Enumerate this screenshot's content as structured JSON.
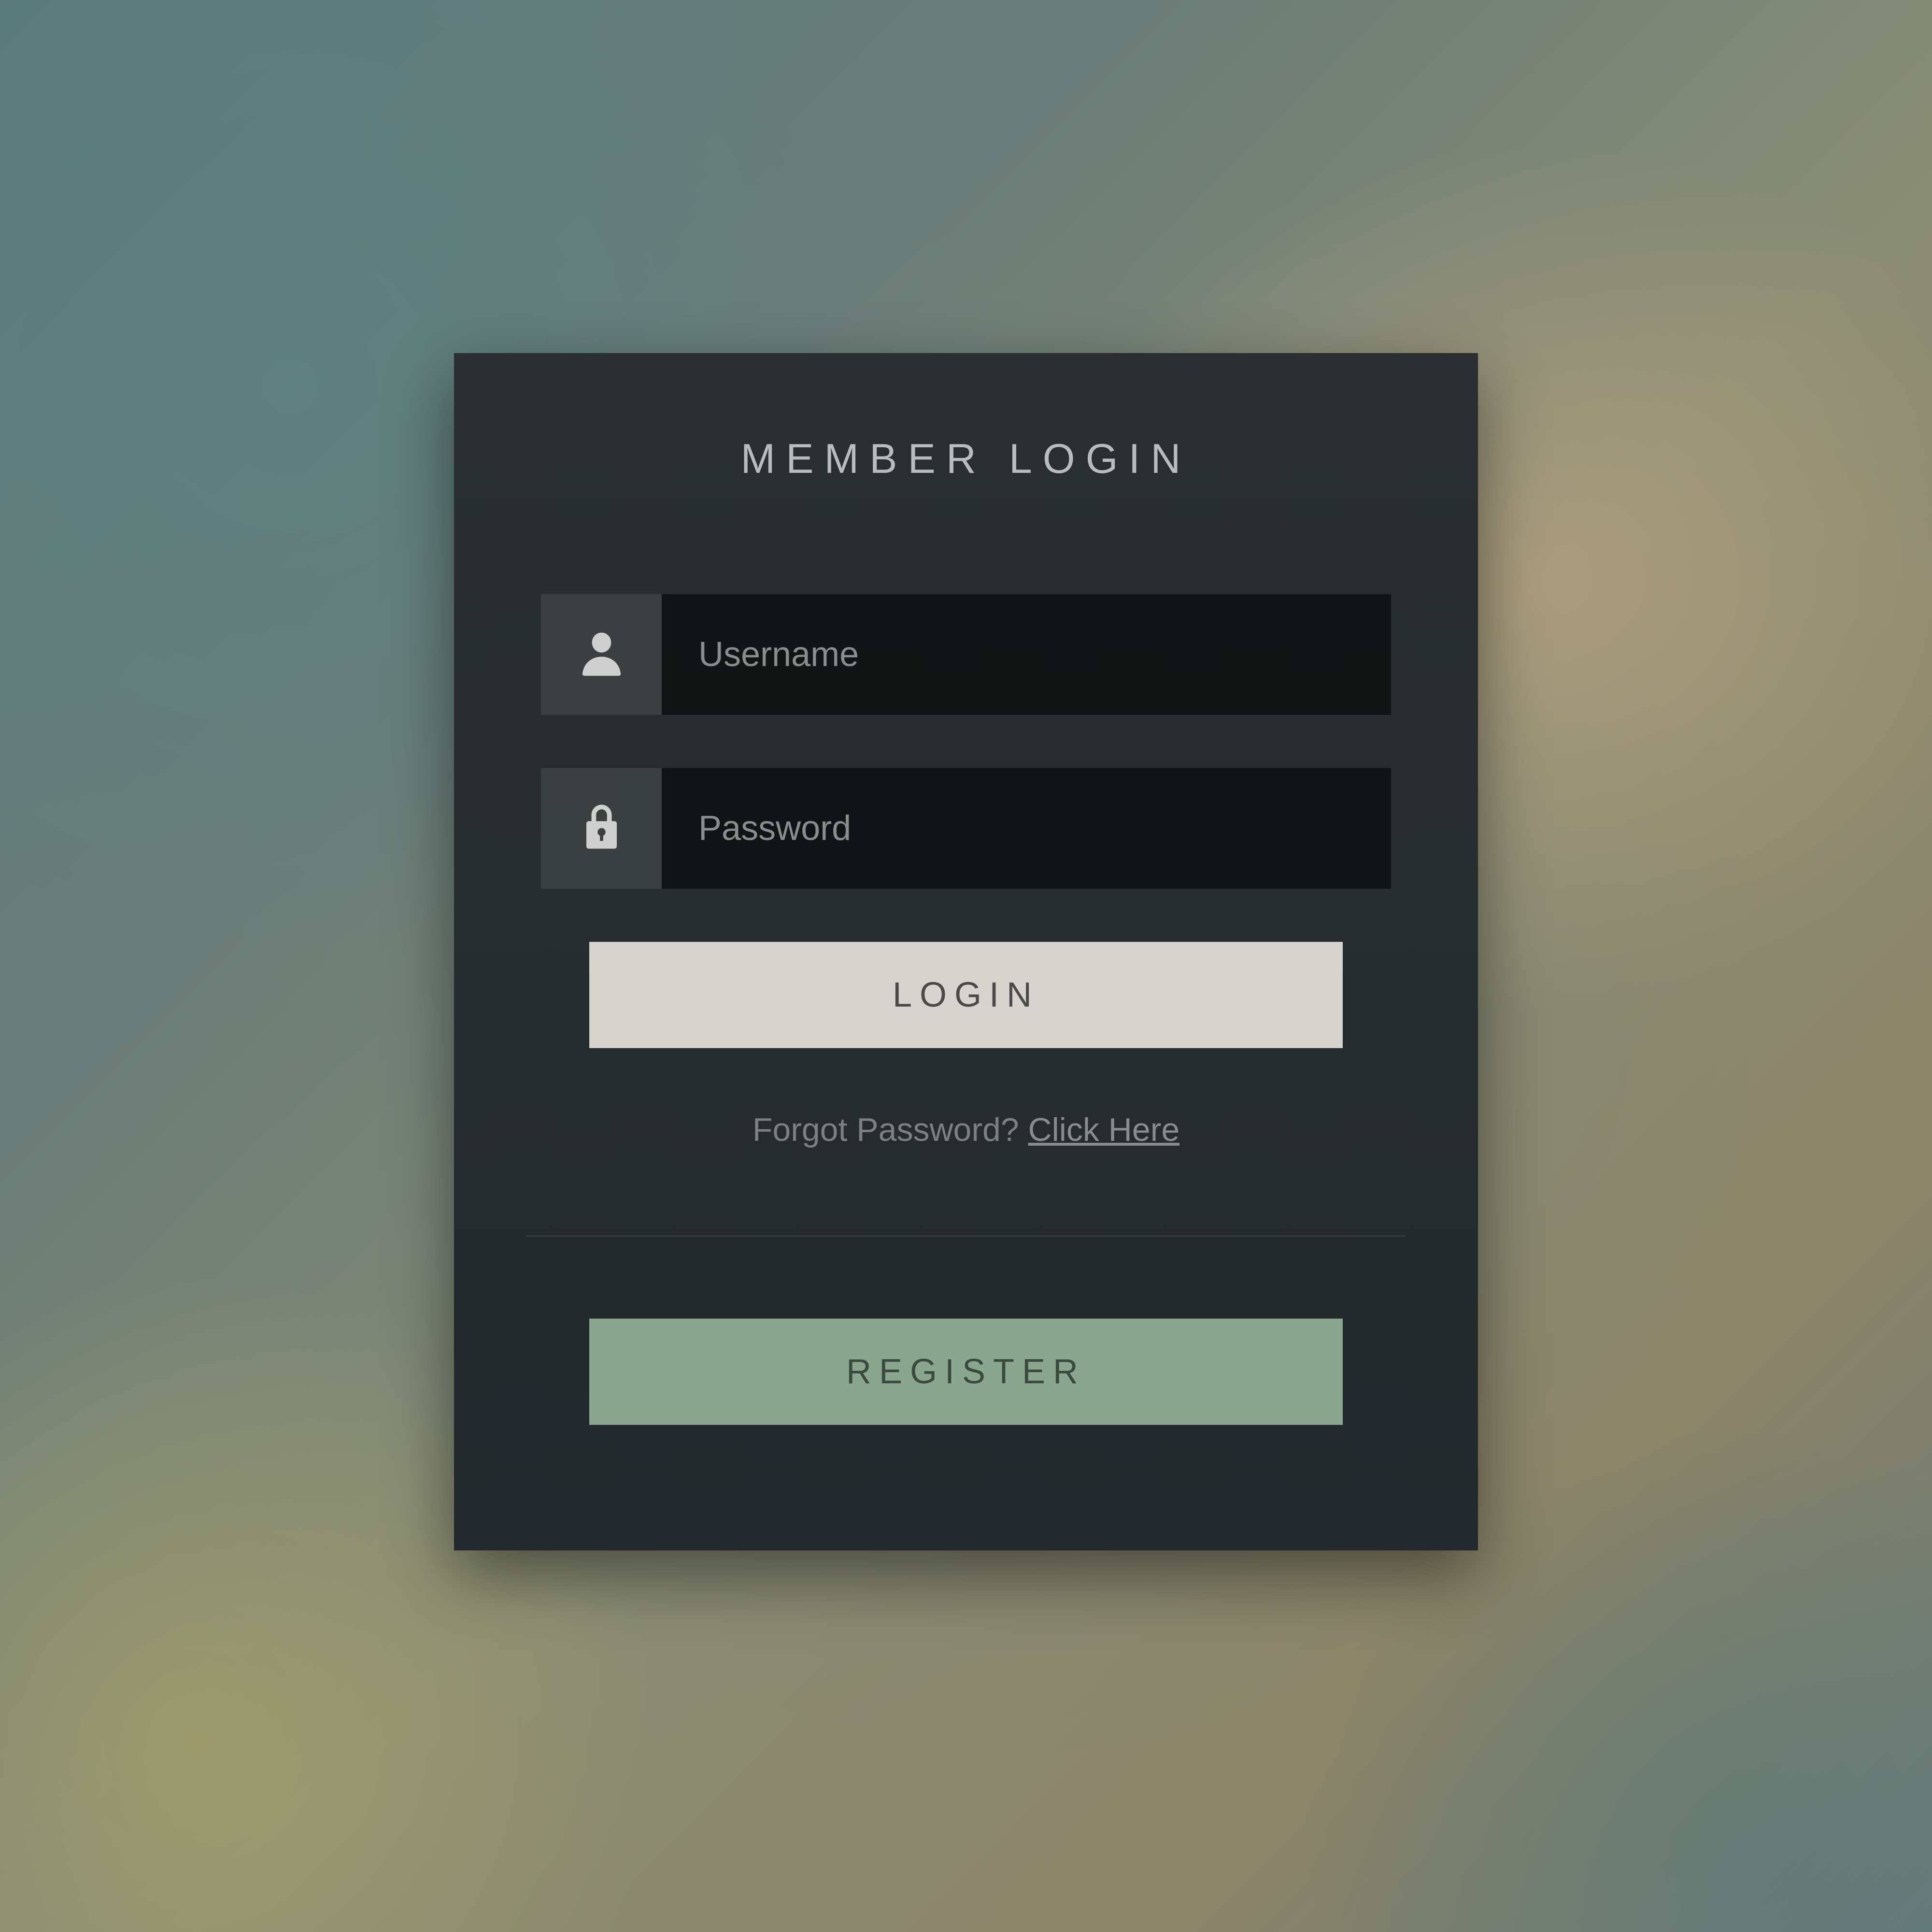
{
  "card": {
    "title": "MEMBER LOGIN",
    "username": {
      "placeholder": "Username",
      "value": ""
    },
    "password": {
      "placeholder": "Password",
      "value": ""
    },
    "login_label": "LOGIN",
    "forgot": {
      "question": "Forgot Password? ",
      "link_text": "Click Here"
    },
    "register_label": "REGISTER"
  },
  "colors": {
    "card_bg": "#262b2d",
    "login_btn": "#d7d4d0",
    "register_btn": "#8ba68f"
  }
}
